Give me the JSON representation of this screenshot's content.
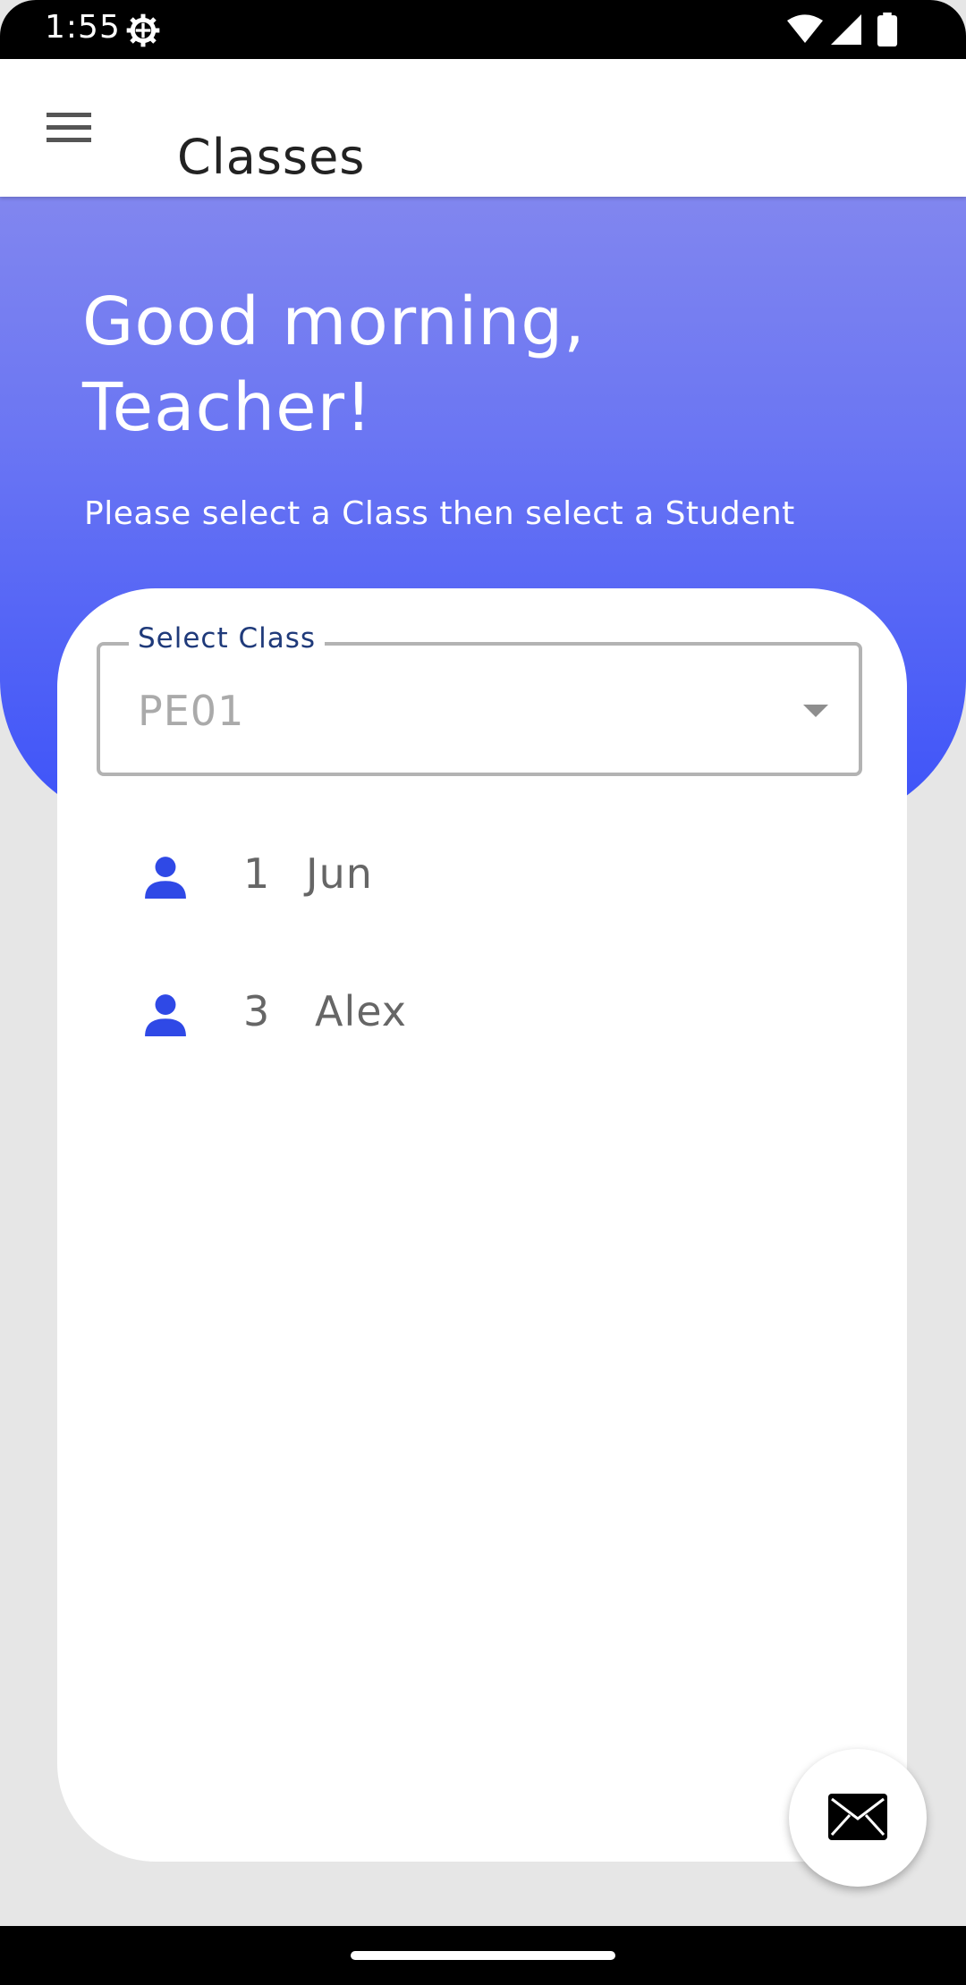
{
  "status_bar": {
    "time": "1:55",
    "icons": [
      "settings-icon",
      "wifi-icon",
      "signal-icon",
      "battery-icon"
    ]
  },
  "app_bar": {
    "title": "Classes",
    "menu_icon": "hamburger-menu-icon"
  },
  "hero": {
    "greeting_line1": "Good morning,",
    "greeting_line2": "Teacher!",
    "subtitle": "Please select a Class then select a Student",
    "gradient_colors": [
      "#8186ef",
      "#3d53f9"
    ]
  },
  "class_select": {
    "label": "Select Class",
    "value": "PE01"
  },
  "students": [
    {
      "id": "1",
      "name": "Jun",
      "icon": "person-icon"
    },
    {
      "id": "3",
      "name": "Alex",
      "icon": "person-icon"
    }
  ],
  "fab": {
    "icon": "mail-icon"
  },
  "colors": {
    "accent": "#2f49e6",
    "label": "#1f3a7a"
  }
}
